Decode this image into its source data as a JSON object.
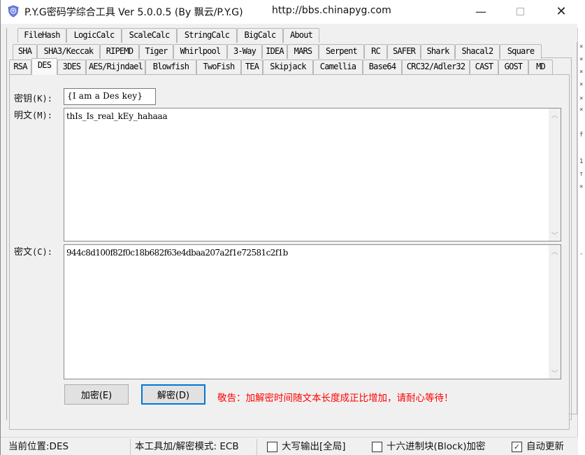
{
  "titlebar": {
    "title": "P.Y.G密码学综合工具 Ver 5.0.0.5 (By 飘云/P.Y.G)",
    "url": "http://bbs.chinapyg.com",
    "minimize_glyph": "—",
    "close_glyph": "✕"
  },
  "tabs": {
    "row1": [
      "FileHash",
      "LogicCalc",
      "ScaleCalc",
      "StringCalc",
      "BigCalc",
      "About"
    ],
    "row2": [
      "SHA",
      "SHA3/Keccak",
      "RIPEMD",
      "Tiger",
      "Whirlpool",
      "3-Way",
      "IDEA",
      "MARS",
      "Serpent",
      "RC",
      "SAFER",
      "Shark",
      "Shacal2",
      "Square"
    ],
    "row3": [
      "RSA",
      "DES",
      "3DES",
      "AES/Rijndael",
      "Blowfish",
      "TwoFish",
      "TEA",
      "Skipjack",
      "Camellia",
      "Base64",
      "CRC32/Adler32",
      "CAST",
      "GOST",
      "MD"
    ],
    "active": "DES"
  },
  "form": {
    "key_label": "密钥",
    "key_hotkey": "(K):",
    "key_value": "{I am a Des key}",
    "plaintext_label": "明文",
    "plaintext_hotkey": "(M):",
    "plaintext_value": "thIs_Is_real_kEy_hahaaa",
    "ciphertext_label": "密文",
    "ciphertext_hotkey": "(C):",
    "ciphertext_value": "944c8d100f82f0c18b682f63e4dbaa207a2f1e72581c2f1b",
    "scroll_up_glyph": "^",
    "scroll_down_glyph": "v"
  },
  "buttons": {
    "encrypt": "加密(E)",
    "decrypt": "解密(D)"
  },
  "warning": "敬告：加解密时间随文本长度成正比增加，请耐心等待！",
  "statusbar": {
    "location": "当前位置:DES",
    "mode": "本工具加/解密模式: ECB",
    "uppercase_label": "大写输出[全局]",
    "uppercase_checked": false,
    "hexblock_label": "十六进制块(Block)加密",
    "hexblock_checked": false,
    "autoupdate_label": "自动更新",
    "autoupdate_checked": true,
    "check_glyph": "✓"
  }
}
